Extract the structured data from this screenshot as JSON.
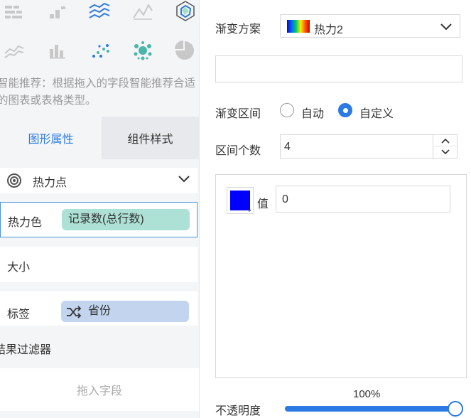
{
  "chart_icons": [
    {
      "name": "heatmap-bars-icon"
    },
    {
      "name": "step-bars-icon"
    },
    {
      "name": "stacked-line-icon",
      "color": "#2c7be5"
    },
    {
      "name": "line-chart-icon"
    },
    {
      "name": "radar-chart-icon",
      "color": "#2c7be5"
    },
    {
      "name": "area-line-icon"
    },
    {
      "name": "column-chart-icon"
    },
    {
      "name": "scatter-dots-icon",
      "color": "#2c7be5"
    },
    {
      "name": "bubble-cluster-icon",
      "color": "#49b6a8"
    },
    {
      "name": "pie-chart-icon"
    }
  ],
  "hint": {
    "text": "智能推荐：根据拖入的字段智能推荐合适的图表或表格类型。"
  },
  "tabs": {
    "active": "图形属性",
    "inactive": "组件样式"
  },
  "chart_type": {
    "label": "热力点"
  },
  "attributes": {
    "heat_color_label": "热力色",
    "heat_color_field": "记录数(总行数)",
    "size_label": "大小",
    "tag_label": "标签",
    "tag_field": "省份"
  },
  "filter": {
    "title": "结果过滤器",
    "drop_placeholder": "拖入字段"
  },
  "style": {
    "gradient_label": "渐变方案",
    "gradient_value": "热力2",
    "range_label": "渐变区间",
    "range_auto": "自动",
    "range_custom": "自定义",
    "range_selected": "自定义",
    "count_label": "区间个数",
    "count_value": "4",
    "value_label": "值",
    "value_input": "0",
    "value_color": "#0000ff",
    "opacity_label": "不透明度",
    "opacity_value": "100%",
    "opacity_fraction": 1.0,
    "accent_color": "#2c7be5"
  }
}
